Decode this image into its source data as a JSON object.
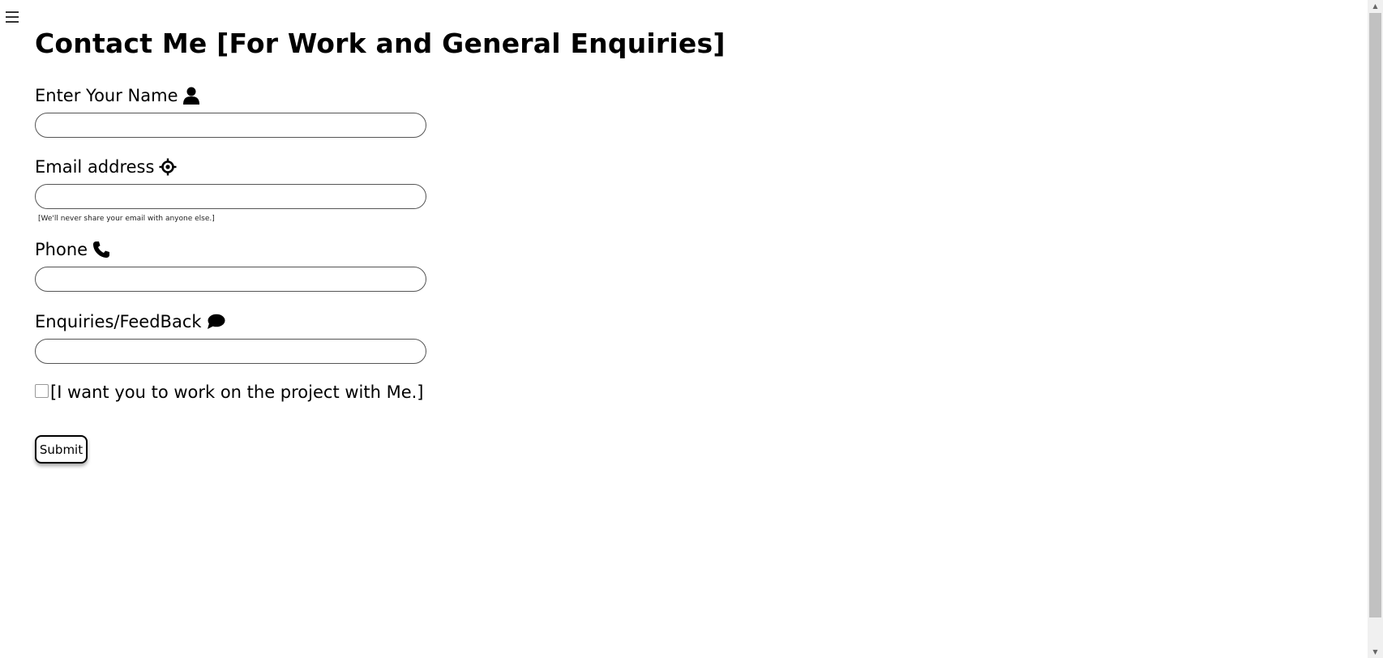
{
  "nav": {
    "menu_icon": "hamburger-menu-icon"
  },
  "page": {
    "title": "Contact Me [For Work and General Enquiries]"
  },
  "form": {
    "name": {
      "label": "Enter Your Name",
      "icon": "user-icon",
      "value": ""
    },
    "email": {
      "label": "Email address",
      "icon": "crosshair-icon",
      "value": "",
      "help": "[We'll never share your email with anyone else.]"
    },
    "phone": {
      "label": "Phone",
      "icon": "phone-icon",
      "value": ""
    },
    "enquiries": {
      "label": "Enquiries/FeedBack",
      "icon": "comment-icon",
      "value": ""
    },
    "checkbox": {
      "label": "[I want you to work on the project with Me.]",
      "checked": false
    },
    "submit_label": "Submit"
  }
}
